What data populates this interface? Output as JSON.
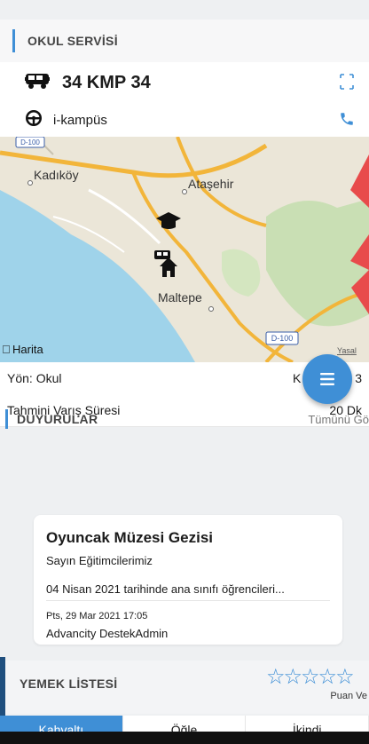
{
  "school_service": {
    "section_title": "OKUL SERVİSİ",
    "plate": "34 KMP 34",
    "driver_name": "i-kampüs"
  },
  "map": {
    "labels": {
      "kadikoy": "Kadıköy",
      "atasehir": "Ataşehir",
      "maltepe": "Maltepe",
      "apple_maps": "Harita",
      "legal": "Yasal",
      "road_d100_a": "D-100",
      "road_d100_b": "D-100"
    }
  },
  "route": {
    "direction_label": "Yön: Okul",
    "direction_value_partial": "K",
    "right_partial": ": 3",
    "eta_label": "Tahmini Varış Süresi",
    "eta_value": "20 Dk"
  },
  "announcements": {
    "section_title": "DUYURULAR",
    "see_all": "Tümünü Gö",
    "card": {
      "title": "Oyuncak Müzesi Gezisi",
      "greeting": "Sayın Eğitimcilerimiz",
      "body": "04 Nisan 2021 tarihinde ana sınıfı öğrencileri...",
      "date": "Pts, 29 Mar 2021 17:05",
      "author": "Advancity DestekAdmin"
    }
  },
  "meal_list": {
    "section_title": "YEMEK LİSTESİ",
    "rating": 0,
    "stars_display": "☆☆☆☆☆",
    "rate_label": "Puan Ve",
    "tabs": [
      "Kahvaltı",
      "Öğle",
      "İkindi"
    ],
    "active_tab": "Kahvaltı"
  },
  "colors": {
    "accent": "#3f8fd6",
    "background": "#eef0f2",
    "section_head": "#f7f7f8"
  },
  "icons": {
    "bus": "bus-icon",
    "steering": "steering-wheel-icon",
    "expand": "expand-icon",
    "phone": "phone-icon",
    "menu": "menu-icon",
    "school": "graduation-cap-icon",
    "home": "home-icon"
  }
}
